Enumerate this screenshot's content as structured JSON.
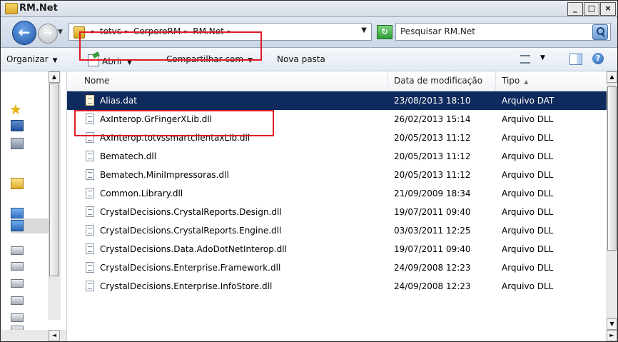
{
  "window": {
    "title": "RM.Net",
    "controls": [
      "_",
      "□",
      "×"
    ]
  },
  "address": {
    "crumbs": [
      "totvs",
      "CorporeRM",
      "RM.Net"
    ],
    "search_placeholder": "Pesquisar RM.Net"
  },
  "toolbar": {
    "organize": "Organizar",
    "open": "Abrir",
    "share": "Compartilhar com",
    "new_folder": "Nova pasta"
  },
  "columns": {
    "name": "Nome",
    "date": "Data de modificação",
    "type": "Tipo"
  },
  "files": [
    {
      "name": "Alias.dat",
      "date": "23/08/2013 18:10",
      "type": "Arquivo DAT",
      "selected": true
    },
    {
      "name": "AxInterop.GrFingerXLib.dll",
      "date": "26/02/2013 15:14",
      "type": "Arquivo DLL"
    },
    {
      "name": "AxInterop.totvssmartclientaxLib.dll",
      "date": "20/05/2013 11:12",
      "type": "Arquivo DLL"
    },
    {
      "name": "Bematech.dll",
      "date": "20/05/2013 11:12",
      "type": "Arquivo DLL"
    },
    {
      "name": "Bematech.MiniImpressoras.dll",
      "date": "20/05/2013 11:12",
      "type": "Arquivo DLL"
    },
    {
      "name": "Common.Library.dll",
      "date": "21/09/2009 18:34",
      "type": "Arquivo DLL"
    },
    {
      "name": "CrystalDecisions.CrystalReports.Design.dll",
      "date": "19/07/2011 09:40",
      "type": "Arquivo DLL"
    },
    {
      "name": "CrystalDecisions.CrystalReports.Engine.dll",
      "date": "03/03/2011 12:25",
      "type": "Arquivo DLL"
    },
    {
      "name": "CrystalDecisions.Data.AdoDotNetInterop.dll",
      "date": "19/07/2011 09:40",
      "type": "Arquivo DLL"
    },
    {
      "name": "CrystalDecisions.Enterprise.Framework.dll",
      "date": "24/09/2008 12:23",
      "type": "Arquivo DLL"
    },
    {
      "name": "CrystalDecisions.Enterprise.InfoStore.dll",
      "date": "24/09/2008 12:23",
      "type": "Arquivo DLL"
    }
  ],
  "colors": {
    "selection": "#0f2a5c",
    "highlight": "#e01b24"
  }
}
